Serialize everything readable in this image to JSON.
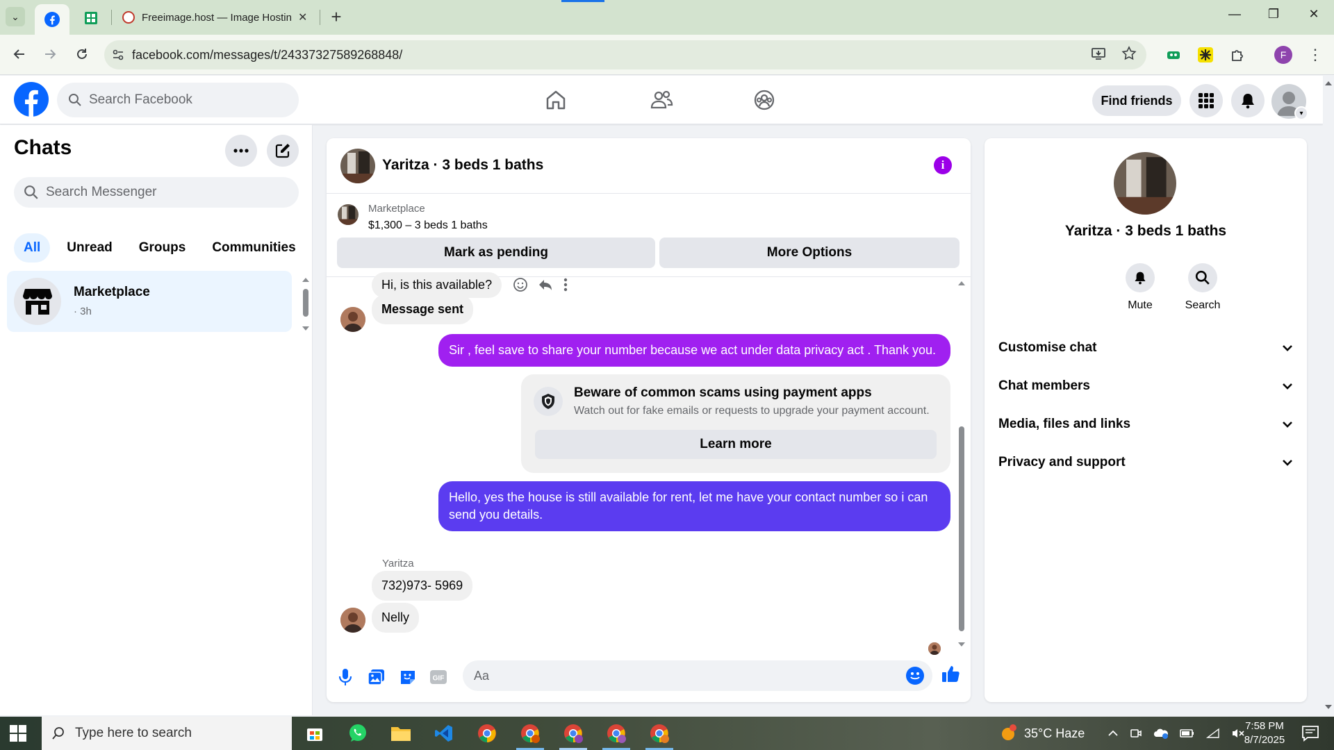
{
  "browser": {
    "tabs": [
      {
        "label": "",
        "icon": "facebook-icon",
        "active": true
      },
      {
        "label": "",
        "icon": "sheets-icon"
      },
      {
        "label": "Freeimage.host — Image Hostin",
        "icon": "freeimage-icon"
      }
    ],
    "url": "facebook.com/messages/t/24337327589268848/",
    "profile_initial": "F"
  },
  "fb_header": {
    "search_placeholder": "Search Facebook",
    "find_friends": "Find friends"
  },
  "chats": {
    "title": "Chats",
    "search_placeholder": "Search Messenger",
    "filters": [
      "All",
      "Unread",
      "Groups",
      "Communities"
    ],
    "active_filter": "All",
    "items": [
      {
        "name": "Marketplace",
        "time": "· 3h"
      }
    ]
  },
  "conversation": {
    "title": "Yaritza · 3 beds 1 baths",
    "marketplace_label": "Marketplace",
    "listing": "$1,300 – 3 beds 1 baths",
    "mark_pending": "Mark as pending",
    "more_options": "More Options",
    "messages": [
      {
        "text": "Hi, is this available?",
        "dir": "in"
      },
      {
        "text": "Message sent",
        "dir": "in"
      },
      {
        "text": "Sir , feel save to share  your number because we act under data privacy act . Thank you.",
        "dir": "out",
        "color": "#a020f0"
      },
      {
        "text": "Hello, yes the house is still available for rent, let me have your contact number so i can send you details.",
        "dir": "out",
        "color": "#5b3cf0"
      },
      {
        "text": "732)973- 5969",
        "dir": "in"
      },
      {
        "text": "Nelly",
        "dir": "in"
      }
    ],
    "sender_name": "Yaritza",
    "warning": {
      "title": "Beware of common scams using payment apps",
      "body": "Watch out for fake emails or requests to upgrade your payment account.",
      "button": "Learn more"
    },
    "composer_placeholder": "Aa"
  },
  "info_panel": {
    "name": "Yaritza · 3 beds 1 baths",
    "actions": [
      "Mute",
      "Search"
    ],
    "sections": [
      "Customise chat",
      "Chat members",
      "Media, files and links",
      "Privacy and support"
    ]
  },
  "taskbar": {
    "search_placeholder": "Type here to search",
    "weather": "35°C  Haze",
    "time": "7:58 PM",
    "date": "8/7/2025"
  },
  "colors": {
    "fb_blue": "#0866ff",
    "out_purple": "#a020f0",
    "out_blue": "#5b3cf0"
  }
}
